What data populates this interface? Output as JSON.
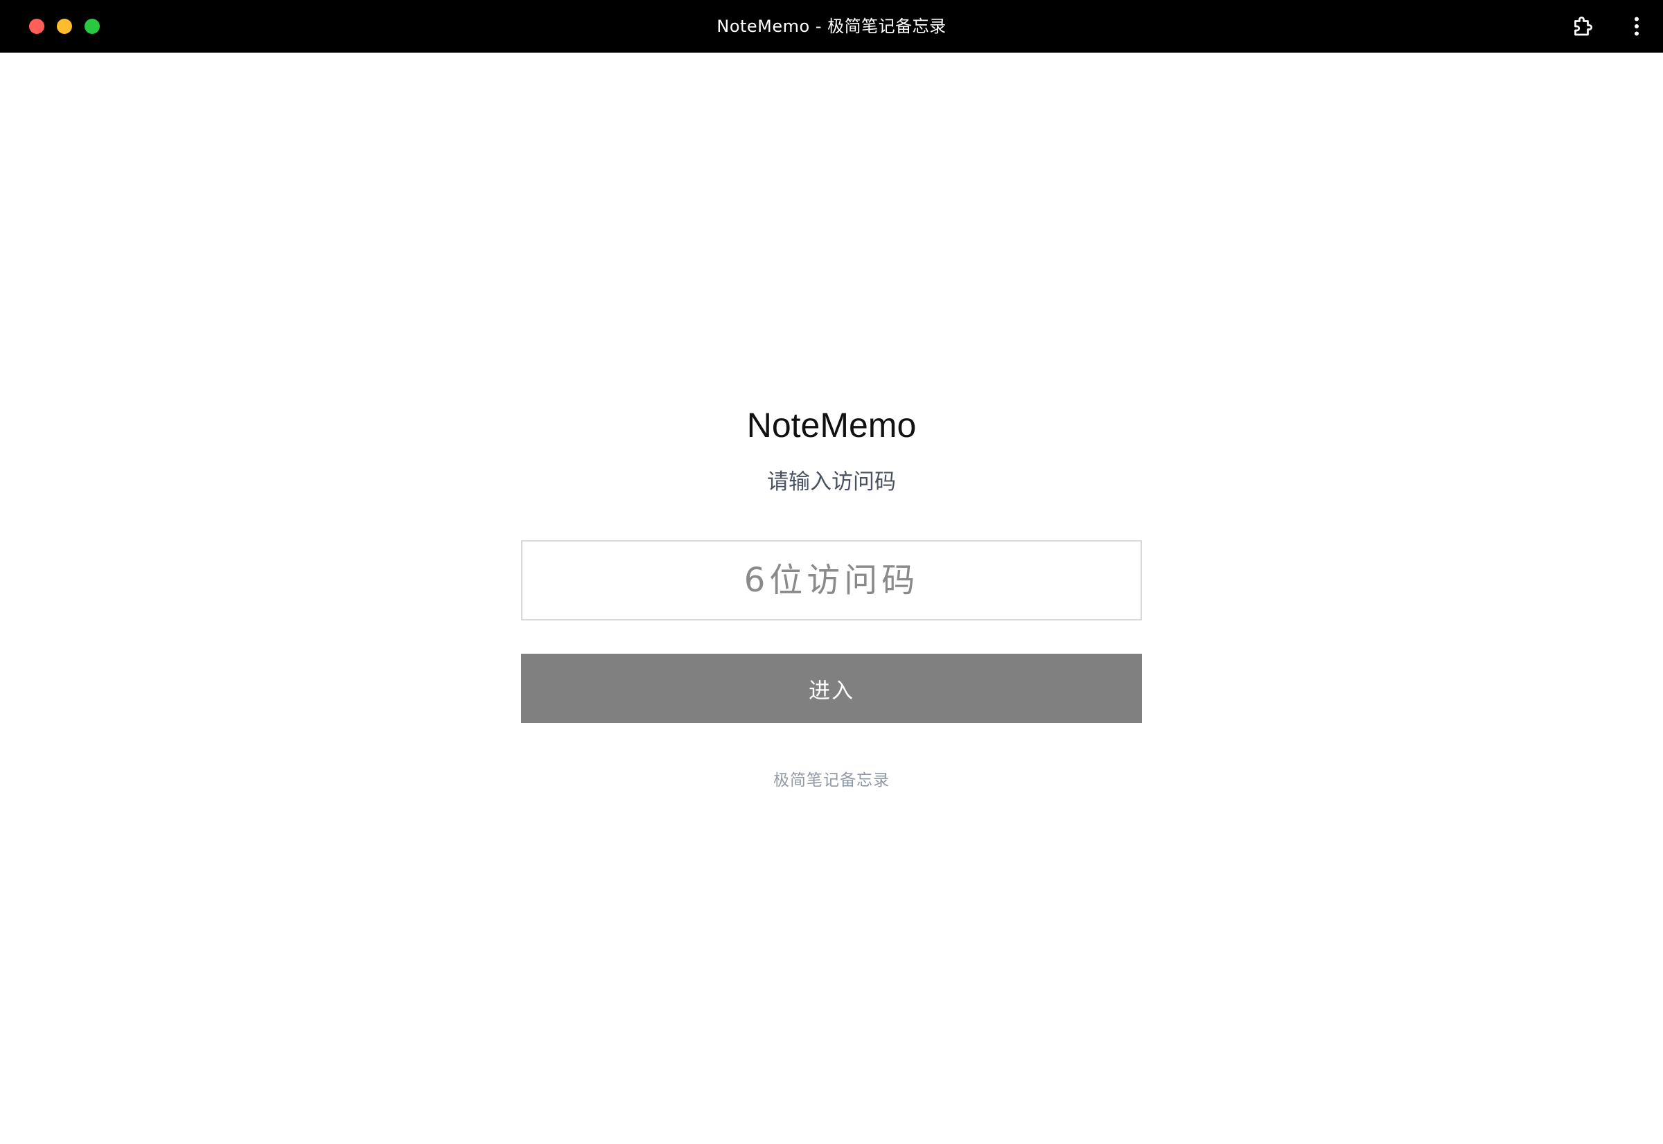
{
  "window": {
    "title": "NoteMemo - 极简笔记备忘录",
    "traffic_lights": {
      "close_color": "#ff5f57",
      "minimize_color": "#febc2e",
      "maximize_color": "#28c840"
    },
    "toolbar_icons": [
      "extension-icon",
      "more-vertical-icon"
    ]
  },
  "login": {
    "app_name": "NoteMemo",
    "subtitle": "请输入访问码",
    "code_input": {
      "value": "",
      "placeholder": "6位访问码"
    },
    "enter_label": "进入",
    "footer": "极简笔记备忘录"
  },
  "colors": {
    "titlebar_bg": "#000000",
    "button_bg": "#808080",
    "input_border": "#d9d9d9",
    "subtitle_text": "#4a5160",
    "footer_text": "#9098a4"
  }
}
